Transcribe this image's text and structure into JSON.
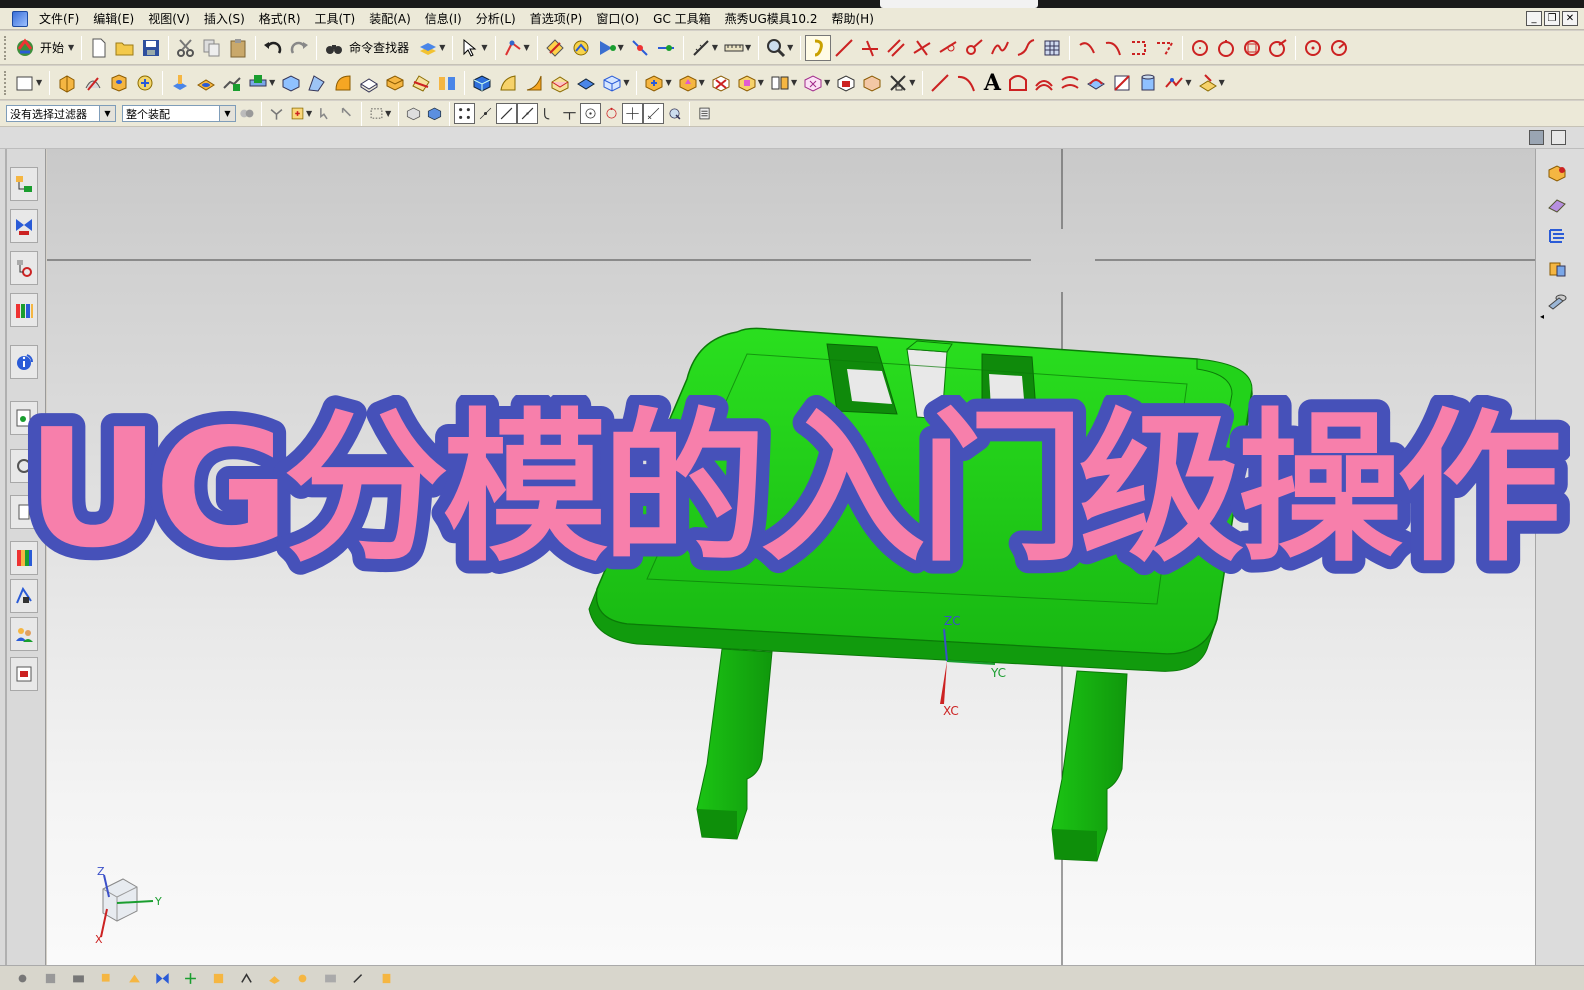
{
  "menu": {
    "items": [
      "文件(F)",
      "编辑(E)",
      "视图(V)",
      "插入(S)",
      "格式(R)",
      "工具(T)",
      "装配(A)",
      "信息(I)",
      "分析(L)",
      "首选项(P)",
      "窗口(O)",
      "GC 工具箱",
      "燕秀UG模具10.2",
      "帮助(H)"
    ]
  },
  "toolbar": {
    "start_label": "开始",
    "command_finder_label": "命令查找器"
  },
  "selection_bar": {
    "filter_value": "没有选择过滤器",
    "scope_value": "整个装配"
  },
  "viewport": {
    "wcs_labels": {
      "zc": "ZC",
      "yc": "YC",
      "xc": "XC"
    },
    "triad_labels": {
      "z": "Z",
      "y": "Y",
      "x": "X"
    },
    "model_color": "#1fcb16"
  },
  "overlay": {
    "title": "UG分模的入门级操作",
    "fill_color": "#f77fab",
    "stroke_color": "#4651b9"
  },
  "colors": {
    "toolbar_bg": "#ece9d8",
    "accent_blue": "#1d4aa0"
  }
}
